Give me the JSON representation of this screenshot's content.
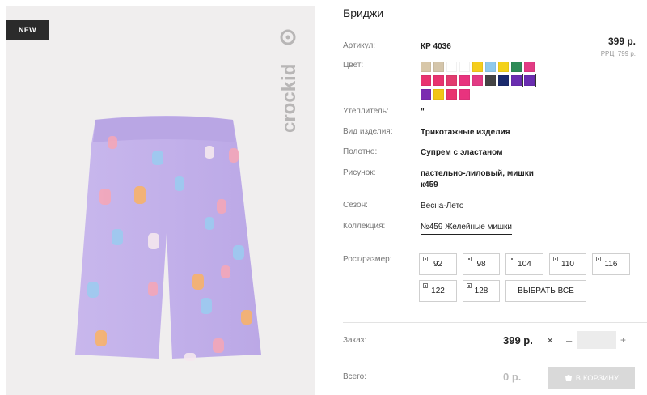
{
  "product": {
    "badge": "NEW",
    "brand": "crockid",
    "title": "Бриджи"
  },
  "price": {
    "value": "399 р.",
    "rrp": "РРЦ: 799 р."
  },
  "attributes": {
    "article": {
      "label": "Артикул:",
      "value": "КР 4036"
    },
    "color": {
      "label": "Цвет:"
    },
    "insulation": {
      "label": "Утеплитель:",
      "value": "\""
    },
    "kind": {
      "label": "Вид изделия:",
      "value": "Трикотажные изделия"
    },
    "fabric": {
      "label": "Полотно:",
      "value": "Супрем с эластаном"
    },
    "pattern": {
      "label": "Рисунок:",
      "value": "пастельно-лиловый, мишки к459"
    },
    "season": {
      "label": "Сезон:",
      "value": "Весна-Лето"
    },
    "collection": {
      "label": "Коллекция:",
      "value": "№459 Желейные мишки"
    }
  },
  "swatches": [
    "#d8c7a8",
    "#d4c5aa",
    "#ffffff",
    "#ffffff",
    "#f5cd1d",
    "#8fc9ec",
    "#f3d21a",
    "#2e8b57",
    "#e23b84",
    "#e8336f",
    "#e8336f",
    "#e23b6f",
    "#e8337e",
    "#e23b84",
    "#444444",
    "#1a2a6c",
    "#6a2db0",
    "#6a2db0",
    "#7b2cb0",
    "#f2c516",
    "#e8336f",
    "#e8337e"
  ],
  "selected_swatch": 17,
  "sizes": {
    "label": "Рост/размер:",
    "items": [
      "92",
      "98",
      "104",
      "110",
      "116",
      "122",
      "128"
    ],
    "select_all": "ВЫБРАТЬ ВСЕ"
  },
  "order": {
    "label": "Заказ:",
    "price": "399 р.",
    "remove": "×",
    "minus": "–",
    "plus": "+",
    "qty": ""
  },
  "total": {
    "label": "Всего:",
    "value": "0 р.",
    "cart_button": "В КОРЗИНУ"
  }
}
